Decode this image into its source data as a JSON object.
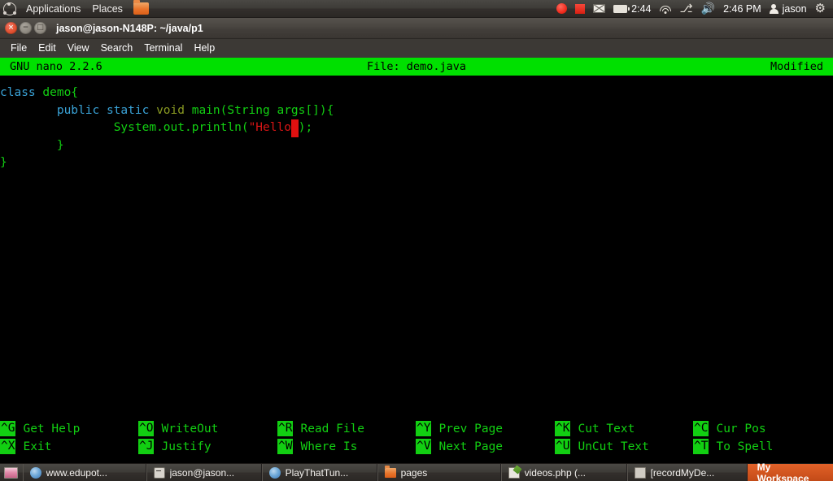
{
  "top_panel": {
    "logo_icon": "ubuntu-logo-icon",
    "menus": [
      "Applications",
      "Places"
    ],
    "folder_icon": "folder-icon",
    "tray": {
      "record_circle_icon": "record-circle-icon",
      "record_stop_icon": "record-stop-icon",
      "mail_icon": "mail-envelope-icon",
      "battery_icon": "battery-icon",
      "battery_time": "2:44",
      "wifi_icon": "wifi-icon",
      "bluetooth_icon": "bluetooth-icon",
      "volume_icon": "volume-icon",
      "clock": "2:46 PM",
      "user_icon": "user-icon",
      "user_name": "jason",
      "gear_icon": "gear-icon"
    }
  },
  "window": {
    "title": "jason@jason-N148P: ~/java/p1",
    "close_glyph": "×",
    "min_glyph": "−",
    "max_glyph": "□"
  },
  "menubar": {
    "items": [
      "File",
      "Edit",
      "View",
      "Search",
      "Terminal",
      "Help"
    ]
  },
  "nano": {
    "version": "GNU nano 2.2.6",
    "file_label": "File: demo.java",
    "status": "Modified",
    "code_lines": [
      {
        "segments": [
          {
            "text": "class ",
            "cls": "c-key"
          },
          {
            "text": "demo{",
            "cls": "c-green"
          }
        ]
      },
      {
        "segments": [
          {
            "text": "        ",
            "cls": "c-green"
          },
          {
            "text": "public static ",
            "cls": "c-key"
          },
          {
            "text": "void ",
            "cls": "c-type"
          },
          {
            "text": "main(String args[]){",
            "cls": "c-green"
          }
        ]
      },
      {
        "segments": [
          {
            "text": "                ",
            "cls": "c-green"
          },
          {
            "text": "System.out.println(",
            "cls": "c-green"
          },
          {
            "text": "\"Hello",
            "cls": "c-str"
          },
          {
            "text": "\"",
            "cls": "cursor"
          },
          {
            "text": ");",
            "cls": "c-green"
          }
        ]
      },
      {
        "segments": [
          {
            "text": "        }",
            "cls": "c-green"
          }
        ]
      },
      {
        "segments": [
          {
            "text": "}",
            "cls": "c-green"
          }
        ]
      }
    ],
    "shortcuts_row1": [
      {
        "key": "^G",
        "label": "Get Help"
      },
      {
        "key": "^O",
        "label": "WriteOut"
      },
      {
        "key": "^R",
        "label": "Read File"
      },
      {
        "key": "^Y",
        "label": "Prev Page"
      },
      {
        "key": "^K",
        "label": "Cut Text"
      },
      {
        "key": "^C",
        "label": "Cur Pos"
      }
    ],
    "shortcuts_row2": [
      {
        "key": "^X",
        "label": "Exit"
      },
      {
        "key": "^J",
        "label": "Justify"
      },
      {
        "key": "^W",
        "label": "Where Is"
      },
      {
        "key": "^V",
        "label": "Next Page"
      },
      {
        "key": "^U",
        "label": "UnCut Text"
      },
      {
        "key": "^T",
        "label": "To Spell"
      }
    ]
  },
  "taskbar": {
    "show_desktop_icon": "show-desktop-icon",
    "items": [
      {
        "label": "www.edupot...",
        "icon": "ico-ff"
      },
      {
        "label": "jason@jason...",
        "icon": "ico-term"
      },
      {
        "label": "PlayThatTun...",
        "icon": "ico-ff"
      },
      {
        "label": "pages",
        "icon": "ico-folder"
      },
      {
        "label": "videos.php (...",
        "icon": "ico-doc"
      },
      {
        "label": "[recordMyDe...",
        "icon": "ico-win"
      }
    ],
    "workspace": "My Workspace",
    "workspace_color": "#d2551f"
  }
}
